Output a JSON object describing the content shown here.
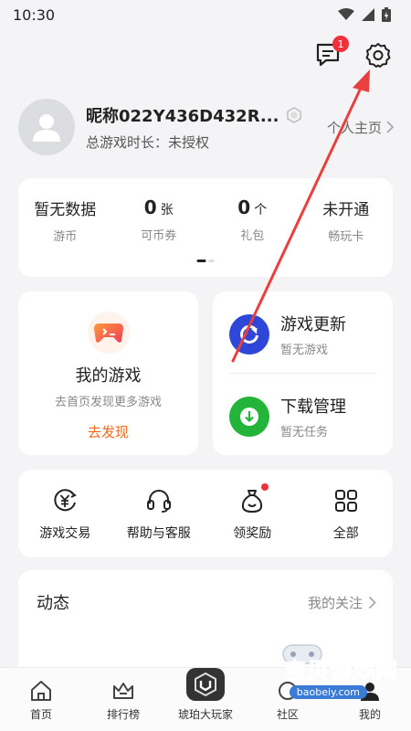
{
  "status_bar": {
    "time": "10:30"
  },
  "header": {
    "message_badge": "1"
  },
  "profile": {
    "nickname": "昵称022Y436D432R...",
    "playtime": "总游戏时长：未授权",
    "homepage_link": "个人主页"
  },
  "stats": [
    {
      "value": "暂无数据",
      "unit": "",
      "label": "游币"
    },
    {
      "value": "0",
      "unit": "张",
      "label": "可币券"
    },
    {
      "value": "0",
      "unit": "个",
      "label": "礼包"
    },
    {
      "value": "未开通",
      "unit": "",
      "label": "畅玩卡"
    }
  ],
  "my_games": {
    "title": "我的游戏",
    "subtitle": "去首页发现更多游戏",
    "link": "去发现"
  },
  "game_update": {
    "title": "游戏更新",
    "subtitle": "暂无游戏"
  },
  "download_manager": {
    "title": "下载管理",
    "subtitle": "暂无任务"
  },
  "tools": [
    {
      "label": "游戏交易",
      "icon": "yen-exchange-icon"
    },
    {
      "label": "帮助与客服",
      "icon": "headset-icon"
    },
    {
      "label": "领奖励",
      "icon": "reward-bag-icon"
    },
    {
      "label": "全部",
      "icon": "grid-icon"
    }
  ],
  "feed": {
    "title": "动态",
    "follow_link": "我的关注"
  },
  "bottom_nav": [
    {
      "label": "首页"
    },
    {
      "label": "排行榜"
    },
    {
      "label": "琥珀大玩家"
    },
    {
      "label": "社区"
    },
    {
      "label": "我的"
    }
  ],
  "watermark": {
    "text": "宝贝游戏网",
    "url": "baobeiy.com"
  },
  "colors": {
    "accent": "#f06a1c",
    "badge": "#f0303a",
    "update_blue": "#2f47d8",
    "download_green": "#23b43a",
    "arrow": "#e8403e"
  }
}
